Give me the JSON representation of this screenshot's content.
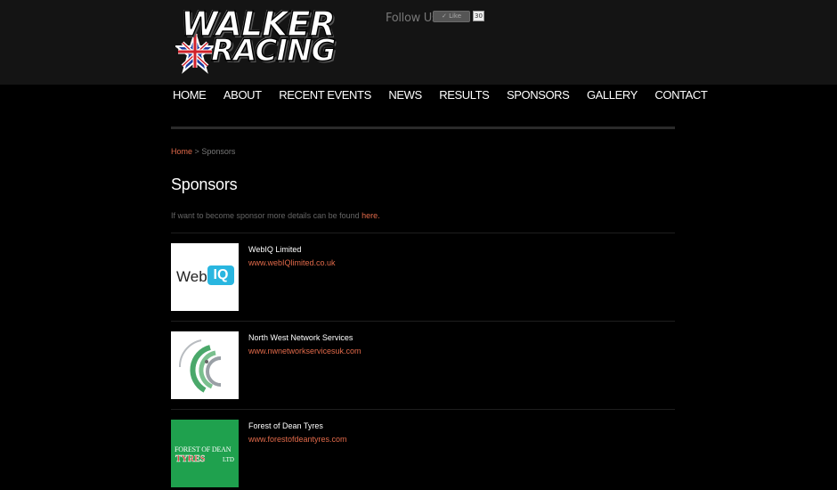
{
  "header": {
    "logo_line1": "WALKER",
    "logo_line2": "RACING",
    "follow_label": "Follow Us:",
    "like_label": "Like",
    "like_count": "30"
  },
  "nav": {
    "items": [
      "HOME",
      "ABOUT",
      "RECENT EVENTS",
      "NEWS",
      "RESULTS",
      "SPONSORS",
      "GALLERY",
      "CONTACT"
    ]
  },
  "breadcrumb": {
    "home": "Home",
    "separator": ">",
    "current": "Sponsors"
  },
  "page": {
    "title": "Sponsors",
    "intro_text": "If want to become sponsor more details can be found",
    "intro_link": "here."
  },
  "sponsors": [
    {
      "name": "WebIQ Limited",
      "url": "www.webIQlimited.co.uk",
      "logo_text_1": "Web",
      "logo_text_2": "IQ"
    },
    {
      "name": "North West Network Services",
      "url": "www.nwnetworkservicesuk.com"
    },
    {
      "name": "Forest of Dean Tyres",
      "url": "www.forestofdeantyres.com",
      "logo_text_1": "FOREST OF DEAN",
      "logo_text_2": "TYRES",
      "logo_text_3": "LTD"
    }
  ],
  "colors": {
    "accent": "#e26a4a",
    "header_bg": "#141414",
    "page_bg": "#000000",
    "webiq_blue": "#29b6e0",
    "fod_green": "#1fa14e"
  }
}
